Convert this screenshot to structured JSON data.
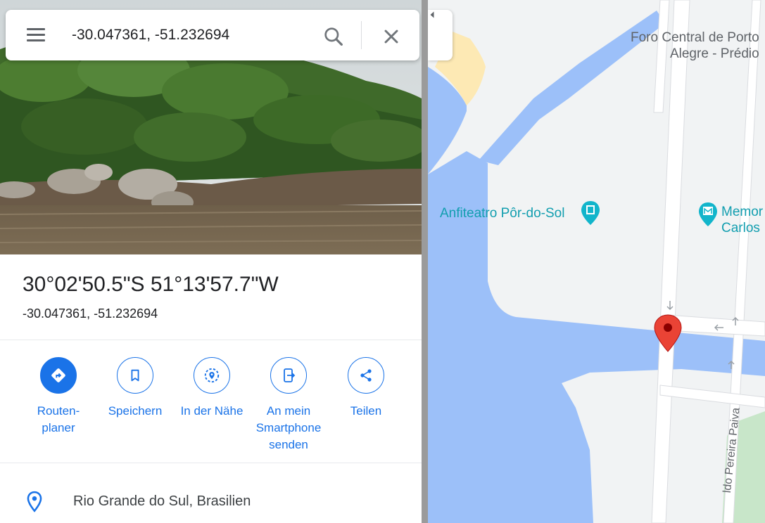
{
  "search": {
    "query": "-30.047361, -51.232694",
    "menu_icon": "hamburger-menu-icon",
    "search_icon": "search-icon",
    "clear_icon": "close-icon"
  },
  "place": {
    "title": "30°02'50.5\"S 51°13'57.7\"W",
    "decimal": "-30.047361, -51.232694",
    "region": "Rio Grande do Sul, Brasilien",
    "region_icon": "location-pin-icon"
  },
  "actions": [
    {
      "id": "directions",
      "line1": "Routen-",
      "line2": "planer",
      "line3": "",
      "icon": "directions-icon"
    },
    {
      "id": "save",
      "line1": "Speichern",
      "line2": "",
      "line3": "",
      "icon": "bookmark-icon"
    },
    {
      "id": "nearby",
      "line1": "In der Nähe",
      "line2": "",
      "line3": "",
      "icon": "nearby-icon"
    },
    {
      "id": "send",
      "line1": "An mein",
      "line2": "Smartphone",
      "line3": "senden",
      "icon": "send-to-phone-icon"
    },
    {
      "id": "share",
      "line1": "Teilen",
      "line2": "",
      "line3": "",
      "icon": "share-icon"
    }
  ],
  "map": {
    "labels": {
      "foro_line1": "Foro Central de Porto",
      "foro_line2": "Alegre - Prédio",
      "anfiteatro": "Anfiteatro Pôr-do-Sol",
      "memorial_line1": "Memor",
      "memorial_line2": "Carlos",
      "street": "ldo Pereira Paiva"
    },
    "colors": {
      "water": "#9cc0f9",
      "land": "#f1f3f4",
      "road": "#ffffff",
      "park": "#c8e6c9",
      "sand": "#fde9b4",
      "poi": "#12b5cb",
      "pin": "#ea4335"
    }
  },
  "theme": {
    "accent": "#1a73e8"
  }
}
